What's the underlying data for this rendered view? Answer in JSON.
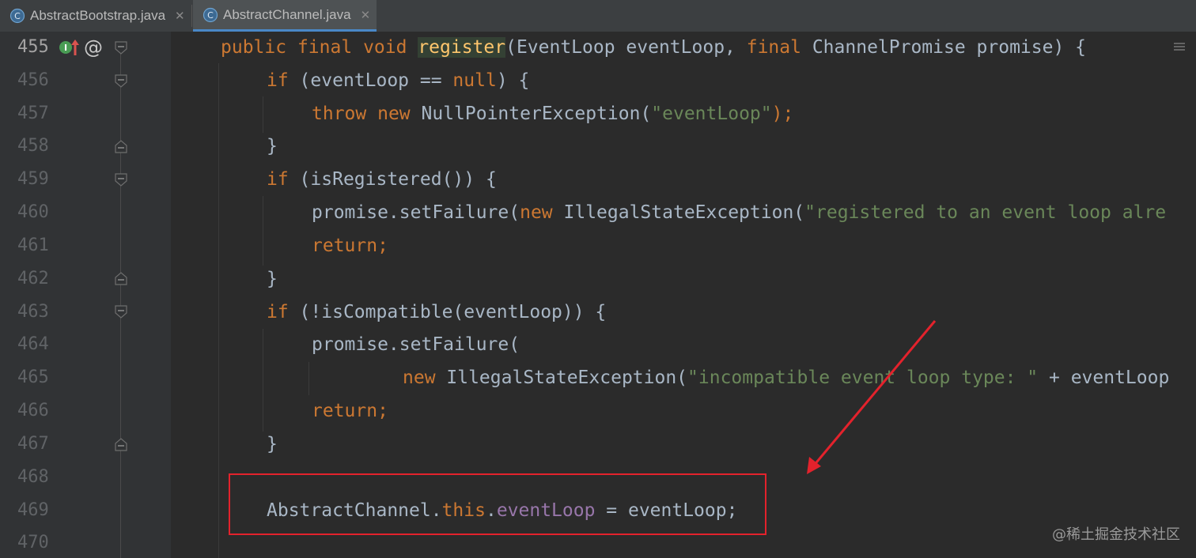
{
  "tabs": [
    {
      "label": "AbstractBootstrap.java",
      "active": false
    },
    {
      "label": "AbstractChannel.java",
      "active": true
    }
  ],
  "gutter": {
    "line_numbers": [
      "455",
      "456",
      "457",
      "458",
      "459",
      "460",
      "461",
      "462",
      "463",
      "464",
      "465",
      "466",
      "467",
      "468",
      "469",
      "470"
    ],
    "line455_markers": {
      "implements": "I",
      "at": "@"
    }
  },
  "code": {
    "l455": {
      "kw1": "public",
      "kw2": "final",
      "kw3": "void",
      "method": "register",
      "params_a": "(EventLoop eventLoop, ",
      "kw4": "final",
      "params_b": " ChannelPromise promise) {"
    },
    "l456": {
      "kw": "if",
      "rest_a": " (eventLoop == ",
      "kw_null": "null",
      "rest_b": ") {"
    },
    "l457": {
      "kw1": "throw",
      "kw2": "new",
      "rest_a": " NullPointerException(",
      "str": "\"eventLoop\"",
      "rest_b": ");"
    },
    "l458": {
      "text": "}"
    },
    "l459": {
      "kw": "if",
      "rest": " (isRegistered()) {"
    },
    "l460": {
      "rest_a": "promise.setFailure(",
      "kw": "new",
      "rest_b": " IllegalStateException(",
      "str": "\"registered to an event loop alre"
    },
    "l461": {
      "kw": "return;"
    },
    "l462": {
      "text": "}"
    },
    "l463": {
      "kw": "if",
      "rest": " (!isCompatible(eventLoop)) {"
    },
    "l464": {
      "text": "promise.setFailure("
    },
    "l465": {
      "kw": "new",
      "rest_a": " IllegalStateException(",
      "str": "\"incompatible event loop type: \"",
      "rest_b": " + eventLoop"
    },
    "l466": {
      "kw": "return;"
    },
    "l467": {
      "text": "}"
    },
    "l469": {
      "a": "AbstractChannel.",
      "this": "this",
      "dot": ".",
      "field": "eventLoop",
      "b": " = eventLoop;"
    }
  },
  "annotation": {
    "box_color": "#e3222c",
    "arrow_color": "#e3222c"
  },
  "watermark": "@稀土掘金技术社区",
  "colors": {
    "keyword": "#cc7832",
    "method": "#ffc66d",
    "string": "#6a8759",
    "field": "#9876aa",
    "text": "#a9b7c6",
    "background": "#2b2b2b"
  }
}
